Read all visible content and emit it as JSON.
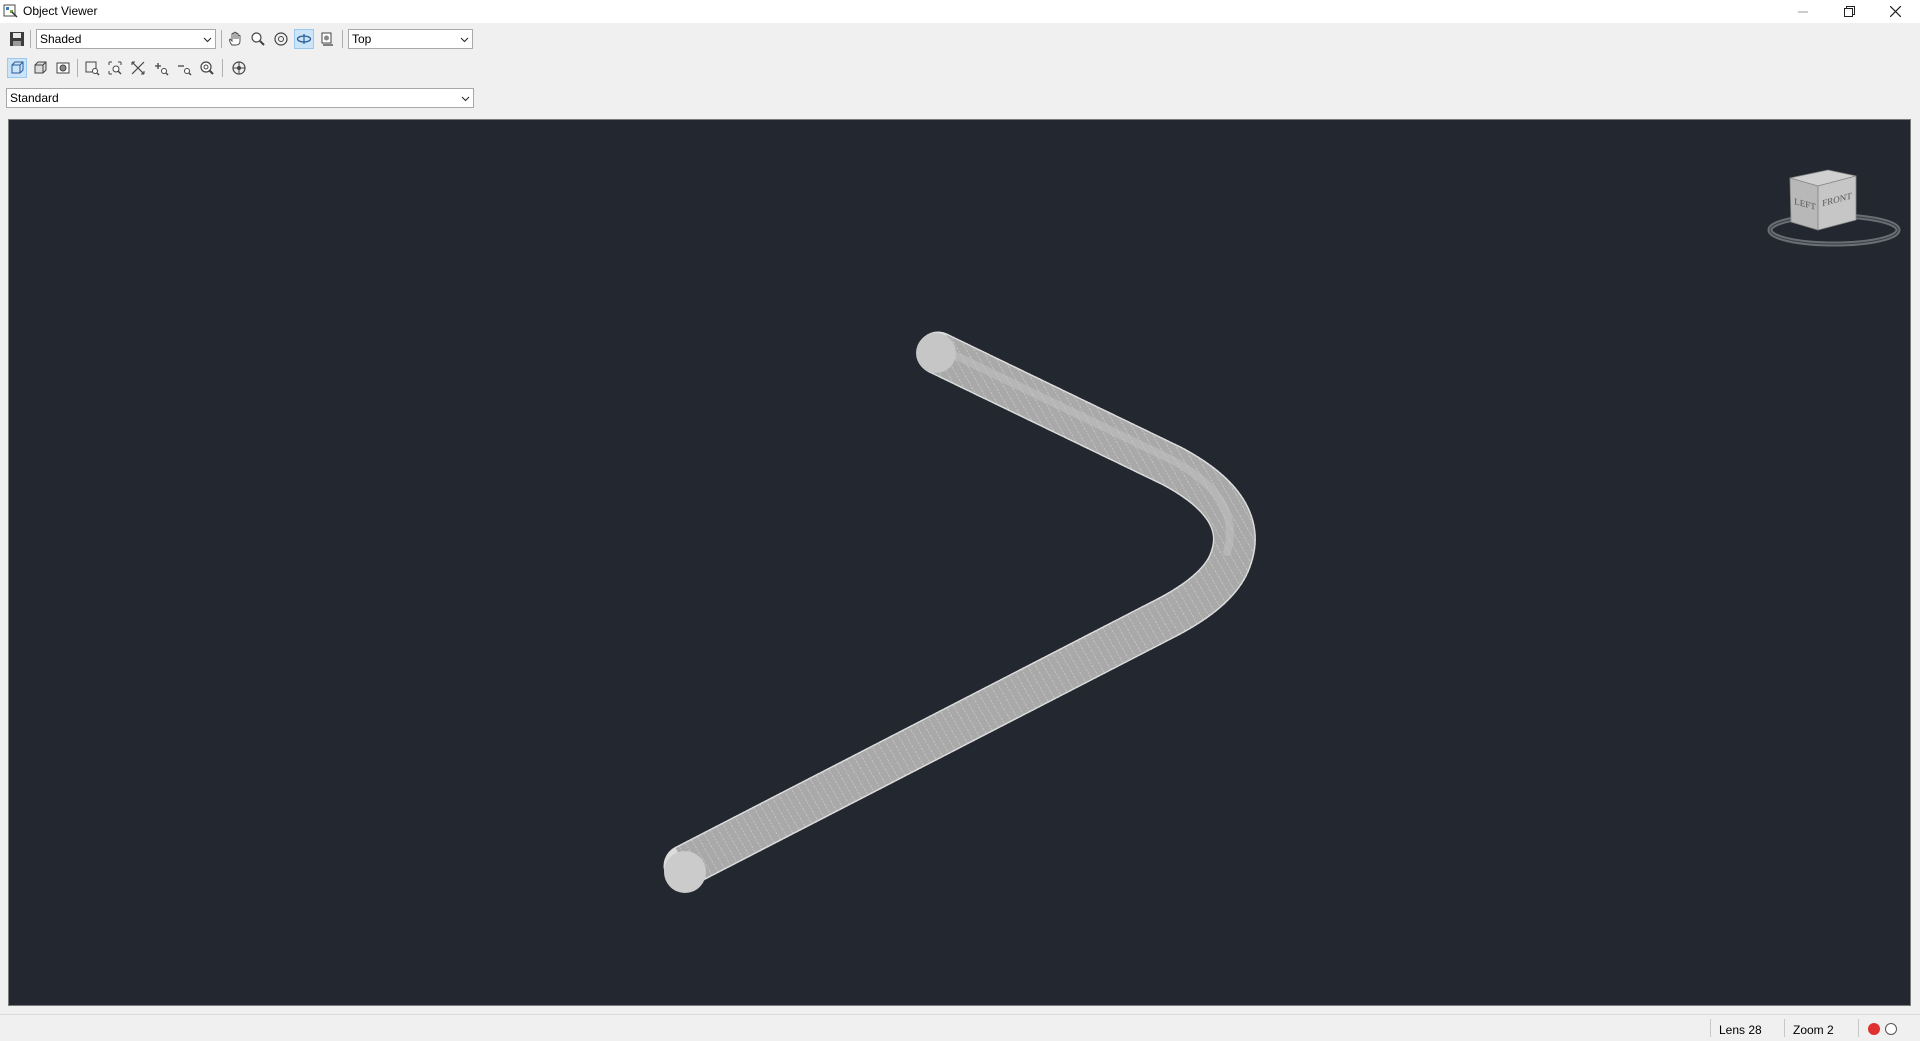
{
  "window": {
    "title": "Object Viewer",
    "controls": [
      "minimize-icon",
      "restore-icon",
      "close-icon"
    ]
  },
  "toolbar": {
    "visual_style": {
      "selected": "Shaded"
    },
    "view": {
      "selected": "Top"
    },
    "ucs": {
      "selected": "Standard"
    },
    "row1_tools": [
      "save-icon",
      "pan-icon",
      "zoom-icon",
      "orbit-icon",
      "free-orbit-icon",
      "continuous-orbit-icon"
    ],
    "row2_tools": [
      "wireframe-icon",
      "hidden-icon",
      "conceptual-icon",
      "zoom-window-icon",
      "zoom-dynamic-icon",
      "zoom-extents-icon",
      "zoom-in-icon",
      "zoom-out-icon",
      "zoom-realtime-icon",
      "ucs-icon"
    ],
    "active_tool": "free-orbit-icon"
  },
  "viewcube": {
    "face_left": "LEFT",
    "face_front": "FRONT"
  },
  "status": {
    "lens": "Lens 28",
    "zoom": "Zoom 2"
  },
  "colors": {
    "viewport_bg": "#232830",
    "pipe": "#a9a9a9",
    "record": "#e03030",
    "active_tool_bg": "#cce4f7"
  }
}
